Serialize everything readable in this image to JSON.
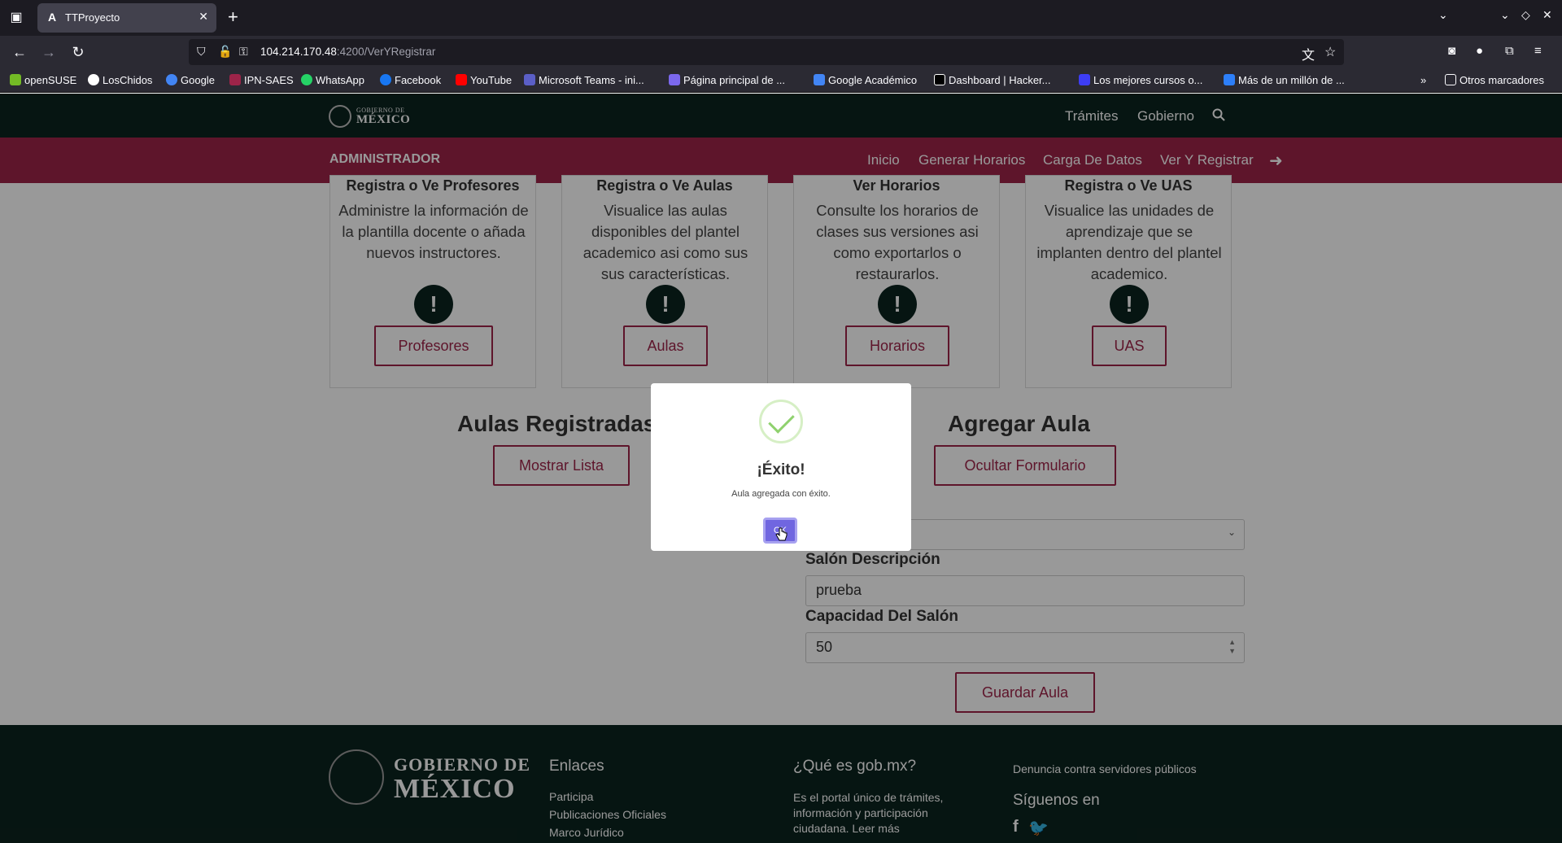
{
  "browser": {
    "tab_title": "TTProyecto",
    "url_host": "104.214.170.48",
    "url_path": ":4200/VerYRegistrar",
    "bookmarks": [
      {
        "label": "openSUSE",
        "color": "#73ba25"
      },
      {
        "label": "LosChidos",
        "color": "#ffffff"
      },
      {
        "label": "Google",
        "color": "#4285f4"
      },
      {
        "label": "IPN-SAES",
        "color": "#9d2449"
      },
      {
        "label": "WhatsApp",
        "color": "#25d366"
      },
      {
        "label": "Facebook",
        "color": "#1877f2"
      },
      {
        "label": "YouTube",
        "color": "#ff0000"
      },
      {
        "label": "Microsoft Teams - ini...",
        "color": "#5b5fc7"
      },
      {
        "label": "Página principal de ...",
        "color": "#7b68ee"
      },
      {
        "label": "Google Académico",
        "color": "#4285f4"
      },
      {
        "label": "Dashboard | Hacker...",
        "color": "#000000"
      },
      {
        "label": "Los mejores cursos o...",
        "color": "#3d3df5"
      },
      {
        "label": "Más de un millón de ...",
        "color": "#2d7ff9"
      }
    ],
    "other_bookmarks": "Otros marcadores"
  },
  "gov_header": {
    "logo_small": "GOBIERNO DE",
    "logo_big": "MÉXICO",
    "nav": [
      "Trámites",
      "Gobierno"
    ]
  },
  "admin_bar": {
    "title": "ADMINISTRADOR",
    "links": [
      "Inicio",
      "Generar Horarios",
      "Carga De Datos",
      "Ver Y Registrar"
    ]
  },
  "cards": [
    {
      "title": "Registra o Ve Profesores",
      "description": "Administre la información de la plantilla docente o añada nuevos instructores.",
      "button": "Profesores"
    },
    {
      "title": "Registra o Ve Aulas",
      "description": "Visualice las aulas disponibles del plantel academico asi como sus sus características.",
      "button": "Aulas"
    },
    {
      "title": "Ver Horarios",
      "description": "Consulte los horarios de clases sus versiones asi como exportarlos o restaurarlos.",
      "button": "Horarios"
    },
    {
      "title": "Registra o Ve UAS",
      "description": "Visualice las unidades de aprendizaje que se implanten dentro del plantel academico.",
      "button": "UAS"
    }
  ],
  "aulas_section": {
    "title": "Aulas Registradas",
    "button": "Mostrar Lista"
  },
  "agregar_section": {
    "title": "Agregar Aula",
    "toggle_button": "Ocultar Formulario",
    "descripcion_label": "Salón Descripción",
    "descripcion_value": "prueba",
    "capacidad_label": "Capacidad Del Salón",
    "capacidad_value": "50",
    "save_button": "Guardar Aula"
  },
  "footer": {
    "logo_small": "GOBIERNO DE",
    "logo_big": "MÉXICO",
    "enlaces_title": "Enlaces",
    "enlaces": [
      "Participa",
      "Publicaciones Oficiales",
      "Marco Jurídico"
    ],
    "que_es_title": "¿Qué es gob.mx?",
    "que_es_text": "Es el portal único de trámites, información y participación ciudadana. Leer más",
    "denuncia": "Denuncia contra servidores públicos",
    "siguenos": "Síguenos en"
  },
  "modal": {
    "title": "¡Éxito!",
    "text": "Aula agregada con éxito.",
    "ok": "OK"
  },
  "colors": {
    "primary": "#9d2449",
    "dark_green": "#0b231e",
    "swal_confirm": "#7066e0"
  }
}
